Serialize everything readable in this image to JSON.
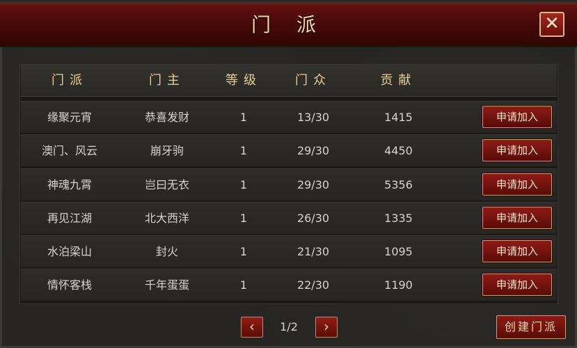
{
  "window": {
    "title": "门 派"
  },
  "table": {
    "headers": [
      "门派",
      "门主",
      "等级",
      "门众",
      "贡献"
    ],
    "rows": [
      {
        "name": "缘聚元宵",
        "leader": "恭喜发财",
        "level": "1",
        "members": "13/30",
        "contribution": "1415",
        "action": "申请加入"
      },
      {
        "name": "澳门、风云",
        "leader": "崩牙驹",
        "level": "1",
        "members": "29/30",
        "contribution": "4450",
        "action": "申请加入"
      },
      {
        "name": "神魂九霄",
        "leader": "岂曰无衣",
        "level": "1",
        "members": "29/30",
        "contribution": "5356",
        "action": "申请加入"
      },
      {
        "name": "再见江湖",
        "leader": "北大西洋",
        "level": "1",
        "members": "26/30",
        "contribution": "1335",
        "action": "申请加入"
      },
      {
        "name": "水泊梁山",
        "leader": "封火",
        "level": "1",
        "members": "21/30",
        "contribution": "1095",
        "action": "申请加入"
      },
      {
        "name": "情怀客栈",
        "leader": "千年蛋蛋",
        "level": "1",
        "members": "22/30",
        "contribution": "1190",
        "action": "申请加入"
      }
    ]
  },
  "pager": {
    "page": "1/2",
    "prev_icon": "chevron-left-icon",
    "next_icon": "chevron-right-icon"
  },
  "actions": {
    "create_label": "创建门派"
  },
  "icons": {
    "close": "close-icon"
  },
  "colors": {
    "accent_red": "#8c1a14",
    "gold_text": "#e8cf94",
    "body_text": "#d9d4ca"
  }
}
